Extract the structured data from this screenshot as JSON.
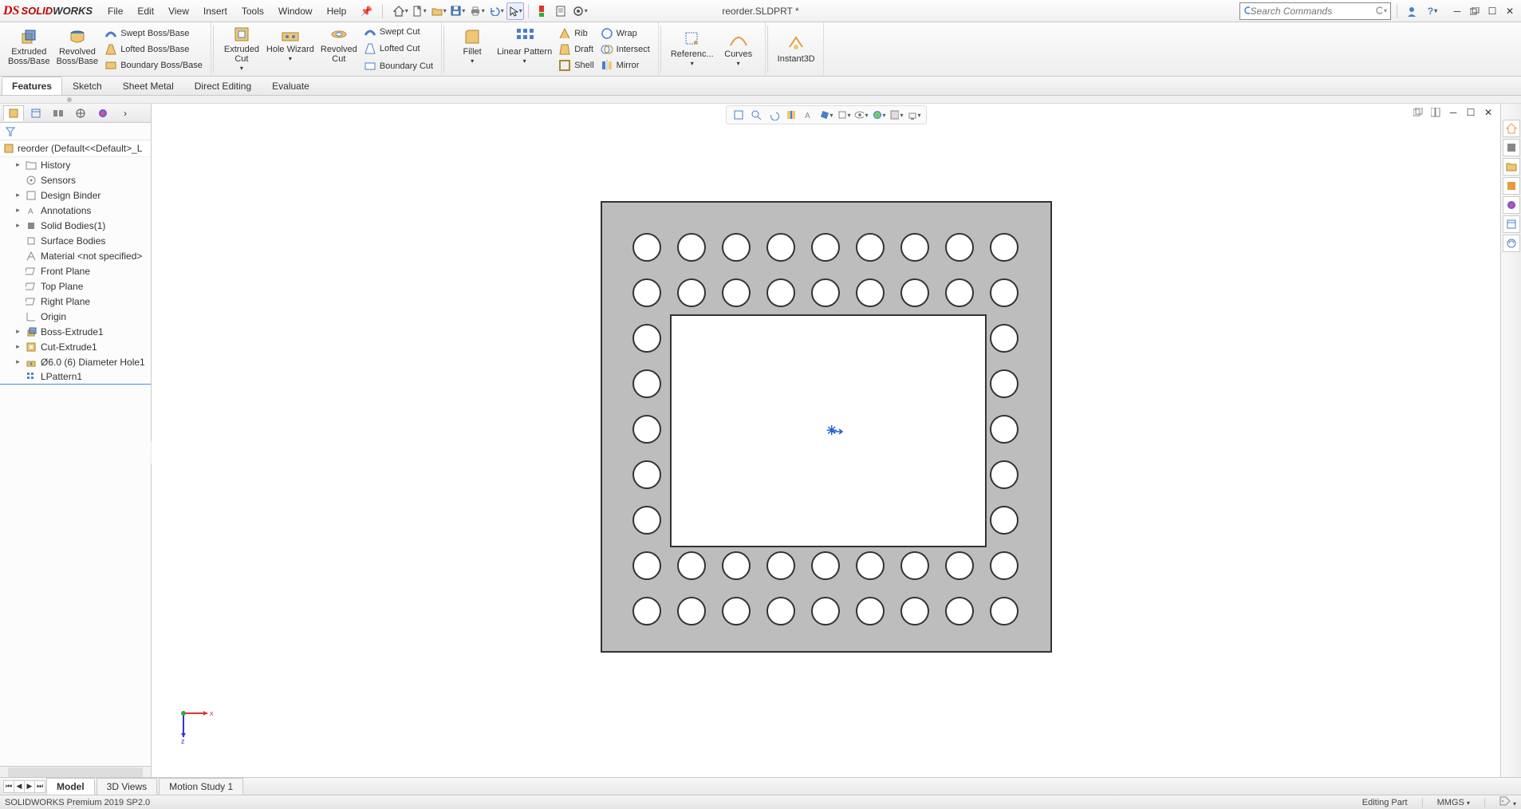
{
  "app": {
    "logo_solid": "SOLID",
    "logo_works": "WORKS"
  },
  "menu": {
    "file": "File",
    "edit": "Edit",
    "view": "View",
    "insert": "Insert",
    "tools": "Tools",
    "window": "Window",
    "help": "Help"
  },
  "document": {
    "title": "reorder.SLDPRT *"
  },
  "search": {
    "placeholder": "Search Commands"
  },
  "ribbon": {
    "extruded_boss1": "Extruded",
    "extruded_boss2": "Boss/Base",
    "revolved_boss1": "Revolved",
    "revolved_boss2": "Boss/Base",
    "swept": "Swept Boss/Base",
    "lofted": "Lofted Boss/Base",
    "boundary": "Boundary Boss/Base",
    "extruded_cut1": "Extruded",
    "extruded_cut2": "Cut",
    "hole_wizard": "Hole Wizard",
    "revolved_cut1": "Revolved",
    "revolved_cut2": "Cut",
    "swept_cut": "Swept Cut",
    "lofted_cut": "Lofted Cut",
    "boundary_cut": "Boundary Cut",
    "fillet": "Fillet",
    "linear_pattern": "Linear Pattern",
    "rib": "Rib",
    "draft": "Draft",
    "shell": "Shell",
    "wrap": "Wrap",
    "intersect": "Intersect",
    "mirror": "Mirror",
    "reference": "Referenc...",
    "curves": "Curves",
    "instant3d": "Instant3D"
  },
  "tabs": {
    "features": "Features",
    "sketch": "Sketch",
    "sheetmetal": "Sheet Metal",
    "direct": "Direct Editing",
    "evaluate": "Evaluate"
  },
  "tree": {
    "root": "reorder  (Default<<Default>_L",
    "history": "History",
    "sensors": "Sensors",
    "design_binder": "Design Binder",
    "annotations": "Annotations",
    "solid_bodies": "Solid Bodies(1)",
    "surface_bodies": "Surface Bodies",
    "material": "Material <not specified>",
    "front_plane": "Front Plane",
    "top_plane": "Top Plane",
    "right_plane": "Right Plane",
    "origin": "Origin",
    "boss_extrude": "Boss-Extrude1",
    "cut_extrude": "Cut-Extrude1",
    "hole": "Ø6.0 (6) Diameter Hole1",
    "lpattern": "LPattern1"
  },
  "bottom_tabs": {
    "model": "Model",
    "views3d": "3D Views",
    "motion": "Motion Study 1"
  },
  "status": {
    "left": "SOLIDWORKS Premium 2019 SP2.0",
    "editing": "Editing Part",
    "units": "MMGS"
  }
}
